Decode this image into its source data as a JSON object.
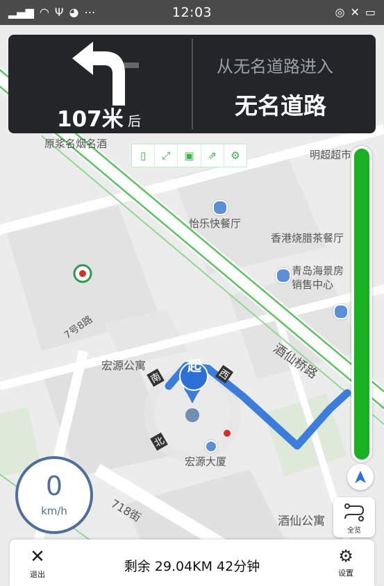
{
  "status_bar": {
    "time": "12:03",
    "left_icons": [
      "signal-icon",
      "wifi-icon",
      "usb-icon",
      "cat-icon",
      "more-icon"
    ],
    "right_icons": [
      "location-icon",
      "mute-icon",
      "battery-icon"
    ]
  },
  "guidance": {
    "distance_value": "107米",
    "distance_suffix": "后",
    "entry_hint": "从无名道路进入",
    "road_name": "无名道路",
    "turn": "left"
  },
  "map_labels": {
    "shop_1": "原浆名烟名酒",
    "supermarket": "明超超市",
    "restaurant": "怡乐快餐厅",
    "tea_restaurant": "香港烧腊茶餐厅",
    "sales_center": "青岛海景房销售中心",
    "road_jiuxian": "酒仙桥路",
    "road_7": "7号8路",
    "apartment": "宏源公寓",
    "building": "宏源大厦",
    "road_718": "718街",
    "jiuxian_apt": "酒仙公寓",
    "start_marker": "起",
    "dir_north": "南",
    "dir_west": "西",
    "dir_south": "北"
  },
  "speed": {
    "value": "0",
    "unit": "km/h"
  },
  "overview_button": {
    "label": "全览"
  },
  "bottom_bar": {
    "exit_label": "退出",
    "remaining": "剩余 29.04KM  42分钟",
    "settings_label": "设置"
  },
  "route_progress": 1.0,
  "colors": {
    "route": "#3b7ddb",
    "progress": "#19b024",
    "guidance_bg": "#232629"
  }
}
